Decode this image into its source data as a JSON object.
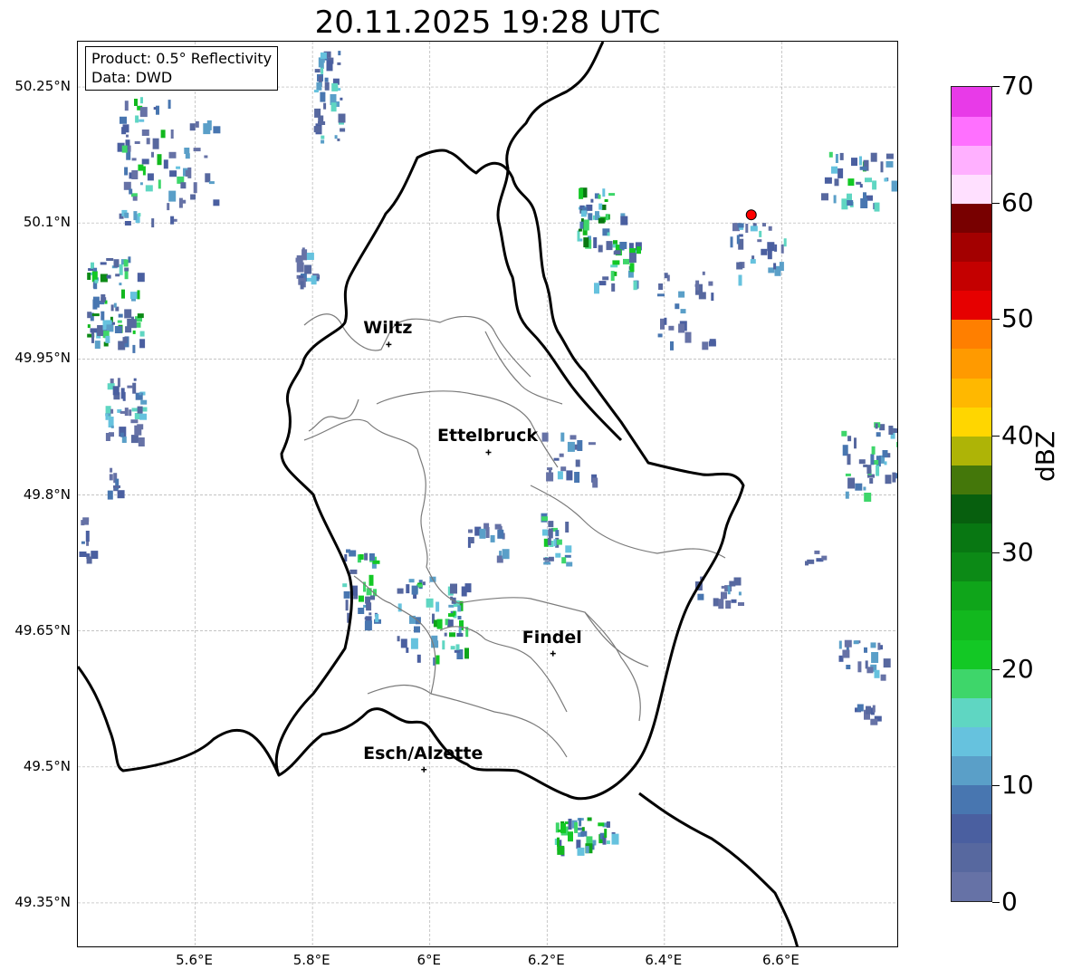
{
  "title": "20.11.2025 19:28 UTC",
  "info": {
    "product": "Product: 0.5° Reflectivity",
    "source": "Data: DWD"
  },
  "axes": {
    "lon_range": [
      5.4,
      6.8
    ],
    "lat_range": [
      49.3,
      50.3
    ],
    "lon_ticks": [
      5.6,
      5.8,
      6.0,
      6.2,
      6.4,
      6.6
    ],
    "lon_tick_labels": [
      "5.6°E",
      "5.8°E",
      "6°E",
      "6.2°E",
      "6.4°E",
      "6.6°E"
    ],
    "lat_ticks": [
      50.25,
      50.1,
      49.95,
      49.8,
      49.65,
      49.5,
      49.35
    ],
    "lat_tick_labels": [
      "50.25°N",
      "50.1°N",
      "49.95°N",
      "49.8°N",
      "49.65°N",
      "49.5°N",
      "49.35°N"
    ],
    "grid": true
  },
  "cities": [
    {
      "name": "Wiltz",
      "lon": 5.93,
      "lat": 49.966
    },
    {
      "name": "Ettelbruck",
      "lon": 6.1,
      "lat": 49.847
    },
    {
      "name": "Findel",
      "lon": 6.21,
      "lat": 49.625
    },
    {
      "name": "Esch/Alzette",
      "lon": 5.99,
      "lat": 49.497
    }
  ],
  "radar_site": {
    "lon": 6.548,
    "lat": 50.109,
    "color": "#ff0000"
  },
  "colorbar": {
    "label": "dBZ",
    "min": 0,
    "max": 70,
    "step": 2.5,
    "ticks": [
      0,
      10,
      20,
      30,
      40,
      50,
      60,
      70
    ],
    "tick_labels": [
      "0",
      "10",
      "20",
      "30",
      "40",
      "50",
      "60",
      "70"
    ],
    "colors": [
      "#6672a6",
      "#57689f",
      "#4a5fa0",
      "#4876b0",
      "#5a9fc8",
      "#66c2de",
      "#5fd6c2",
      "#3ed66a",
      "#13c825",
      "#12b81e",
      "#0fa51a",
      "#0c8a16",
      "#087712",
      "#075f0e",
      "#44770a",
      "#aeb406",
      "#ffd600",
      "#ffb800",
      "#ff9a00",
      "#ff7f00",
      "#e60000",
      "#c40000",
      "#a30000",
      "#780000",
      "#ffe0ff",
      "#ffb0ff",
      "#ff70ff",
      "#e83ae8"
    ]
  }
}
